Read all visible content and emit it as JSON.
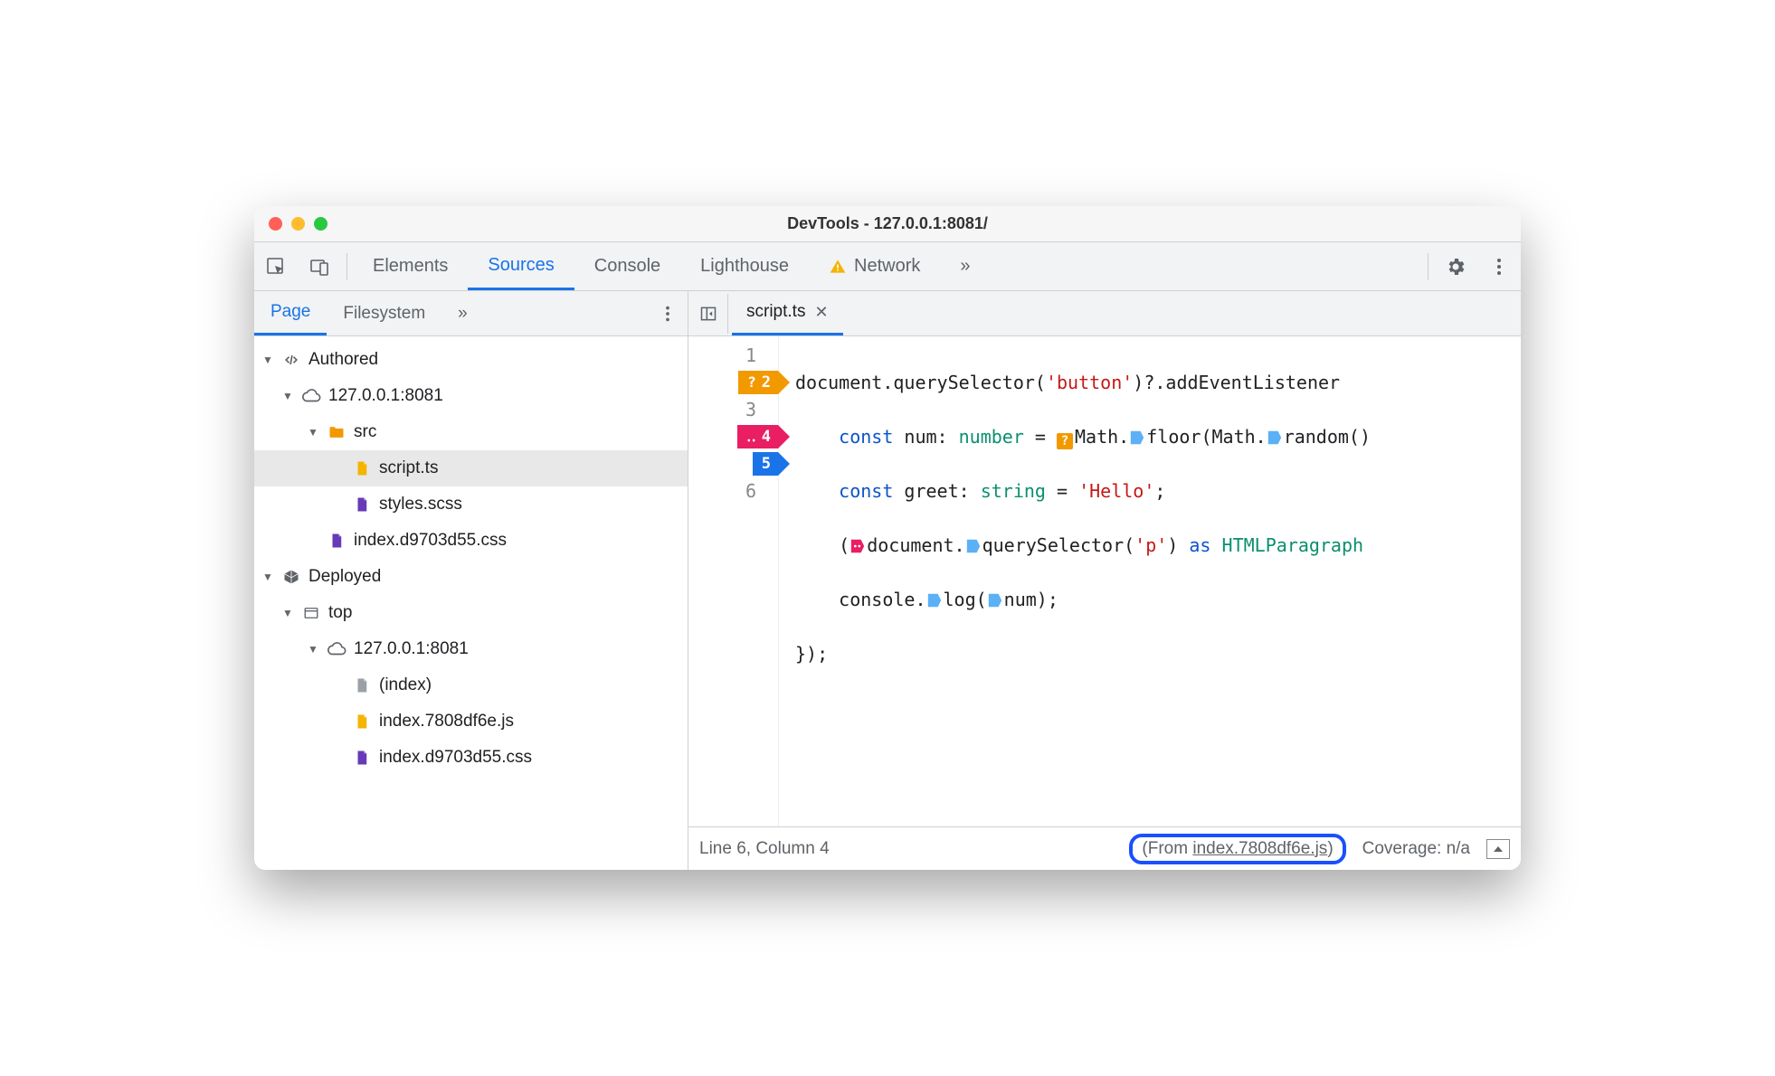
{
  "window": {
    "title": "DevTools - 127.0.0.1:8081/"
  },
  "tabs": {
    "elements": "Elements",
    "sources": "Sources",
    "console": "Console",
    "lighthouse": "Lighthouse",
    "network": "Network",
    "more": "»"
  },
  "sidebar": {
    "page": "Page",
    "filesystem": "Filesystem",
    "more": "»",
    "tree": {
      "authored": "Authored",
      "host1": "127.0.0.1:8081",
      "src": "src",
      "scriptts": "script.ts",
      "stylesscss": "styles.scss",
      "indexcss1": "index.d9703d55.css",
      "deployed": "Deployed",
      "top": "top",
      "host2": "127.0.0.1:8081",
      "indexfile": "(index)",
      "indexjs": "index.7808df6e.js",
      "indexcss2": "index.d9703d55.css"
    }
  },
  "editor": {
    "tab": "script.ts",
    "lines": [
      "1",
      "2",
      "3",
      "4",
      "5",
      "6"
    ],
    "breakpoints": {
      "l2": {
        "prefix": "?",
        "num": "2"
      },
      "l4": {
        "prefix": "‥",
        "num": "4"
      },
      "l5": {
        "prefix": "",
        "num": "5"
      }
    },
    "code": {
      "l1a": "document.querySelector(",
      "l1b": "'button'",
      "l1c": ")?.addEventListener",
      "l2a": "const",
      "l2b": " num: ",
      "l2c": "number",
      "l2d": " = ",
      "l2e": "Math.",
      "l2f": "floor(Math.",
      "l2g": "random()",
      "l3a": "const",
      "l3b": " greet: ",
      "l3c": "string",
      "l3d": " = ",
      "l3e": "'Hello'",
      "l3f": ";",
      "l4a": "(",
      "l4b": "document.",
      "l4c": "querySelector(",
      "l4d": "'p'",
      "l4e": ") ",
      "l4f": "as",
      "l4g": " HTMLParagraph",
      "l5a": "console.",
      "l5b": "log(",
      "l5c": "num);",
      "l6a": "});"
    }
  },
  "status": {
    "pos": "Line 6, Column 4",
    "from_prefix": "(From ",
    "from_link": "index.7808df6e.js",
    "from_suffix": ")",
    "coverage": "Coverage: n/a"
  }
}
